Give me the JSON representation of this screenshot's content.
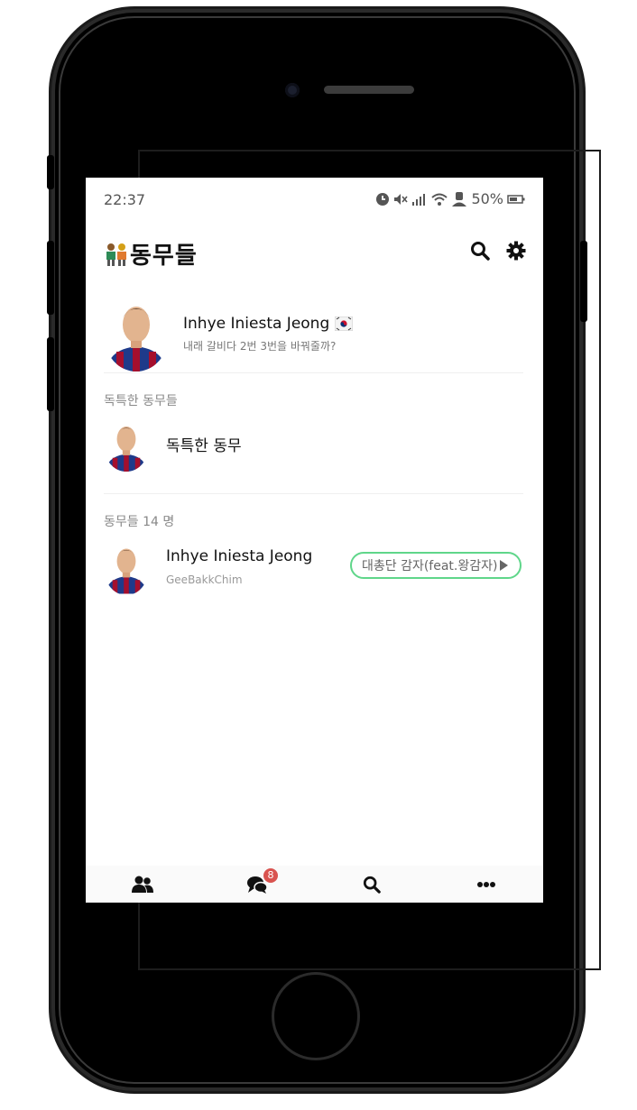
{
  "status": {
    "time": "22:37",
    "battery": "50%"
  },
  "header": {
    "title": "동무들",
    "title_icon": "people-emoji-icon",
    "search_icon": "search-icon",
    "settings_icon": "gear-icon"
  },
  "me": {
    "name": "Inhye Iniesta Jeong",
    "flag_icon": "korea-flag-icon",
    "status_message": "내래 갈비다 2번 3번을 바꿔줄까?"
  },
  "special_friends": {
    "section_label": "독특한 동무들",
    "items": [
      {
        "name": "독특한 동무"
      }
    ]
  },
  "friends": {
    "section_label": "동무들 14 명",
    "items": [
      {
        "name": "Inhye Iniesta Jeong",
        "status_message": "GeeBakkChim",
        "music": "대총단 감자(feat.왕감자)"
      }
    ]
  },
  "tabbar": {
    "tabs": [
      {
        "name": "friends",
        "icon": "friends-icon"
      },
      {
        "name": "chats",
        "icon": "chat-bubbles-icon",
        "badge": "8"
      },
      {
        "name": "search",
        "icon": "search-icon"
      },
      {
        "name": "more",
        "icon": "more-dots-icon"
      }
    ]
  },
  "colors": {
    "accent_green": "#5fd68a",
    "badge_red": "#d9534f"
  }
}
